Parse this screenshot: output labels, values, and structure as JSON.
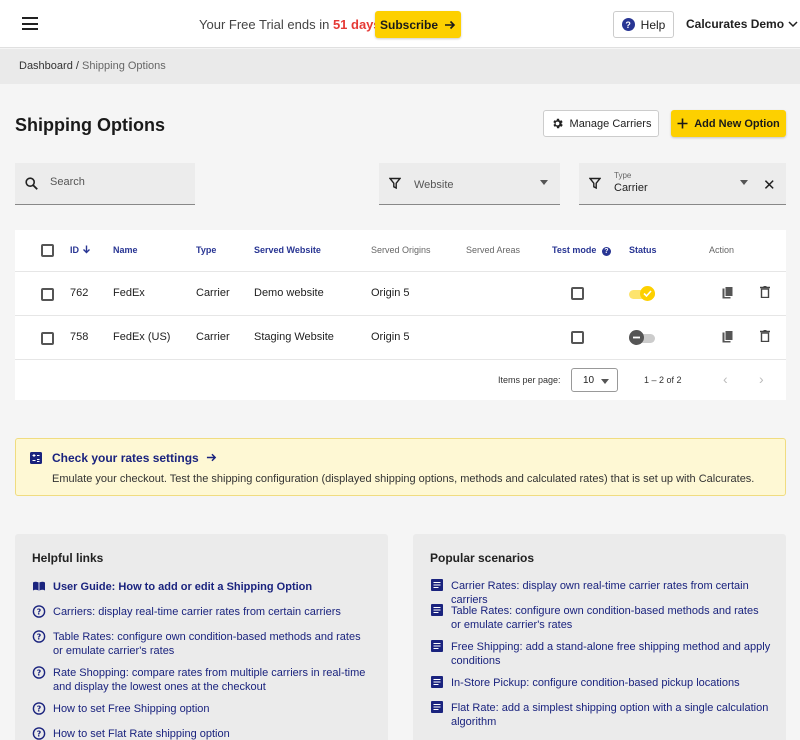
{
  "header": {
    "trial_prefix": "Your Free Trial ends in",
    "trial_days": "51 days",
    "subscribe_label": "Subscribe",
    "help_label": "Help",
    "account_label": "Calcurates Demo"
  },
  "breadcrumb": {
    "root": "Dashboard",
    "current": "Shipping Options"
  },
  "page": {
    "title": "Shipping Options",
    "manage_carriers_label": "Manage Carriers",
    "add_option_label": "Add New Option"
  },
  "filters": {
    "search_placeholder": "Search",
    "website_placeholder": "Website",
    "type_label": "Type",
    "type_value": "Carrier"
  },
  "table": {
    "columns": [
      "ID",
      "Name",
      "Type",
      "Served Website",
      "Served Origins",
      "Served Areas",
      "Test mode",
      "Status",
      "Action"
    ],
    "rows": [
      {
        "id": "762",
        "name": "FedEx",
        "type": "Carrier",
        "website": "Demo website",
        "origins": "Origin 5",
        "areas": "",
        "status": "on"
      },
      {
        "id": "758",
        "name": "FedEx (US)",
        "type": "Carrier",
        "website": "Staging Website",
        "origins": "Origin 5",
        "areas": "",
        "status": "off"
      }
    ],
    "pagination": {
      "items_per_page_label": "Items per page:",
      "page_size": "10",
      "range": "1 – 2 of 2"
    }
  },
  "rates_banner": {
    "title": "Check your rates settings",
    "description": "Emulate your checkout. Test the shipping configuration (displayed shipping options, methods and calculated rates) that is set up with Calcurates."
  },
  "helpful_links": {
    "title": "Helpful links",
    "items": [
      "User Guide: How to add or edit a Shipping Option",
      "Carriers: display real-time carrier rates from certain carriers",
      "Table Rates: configure own condition-based methods and rates or emulate carrier's rates",
      "Rate Shopping: compare rates from multiple carriers in real-time and display the lowest ones at the checkout",
      "How to set Free Shipping option",
      "How to set Flat Rate shipping option"
    ]
  },
  "popular_scenarios": {
    "title": "Popular scenarios",
    "items": [
      "Carrier Rates: display own real-time carrier rates from certain carriers",
      "Table Rates: configure own condition-based methods and rates or emulate carrier's rates",
      "Free Shipping: add a stand-alone free shipping method and apply conditions",
      "In-Store Pickup: configure condition-based pickup locations",
      "Flat Rate: add a simplest shipping option with a single calculation algorithm"
    ]
  },
  "colors": {
    "accent": "#fdd000",
    "link": "#1a237e",
    "danger": "#e53935"
  }
}
